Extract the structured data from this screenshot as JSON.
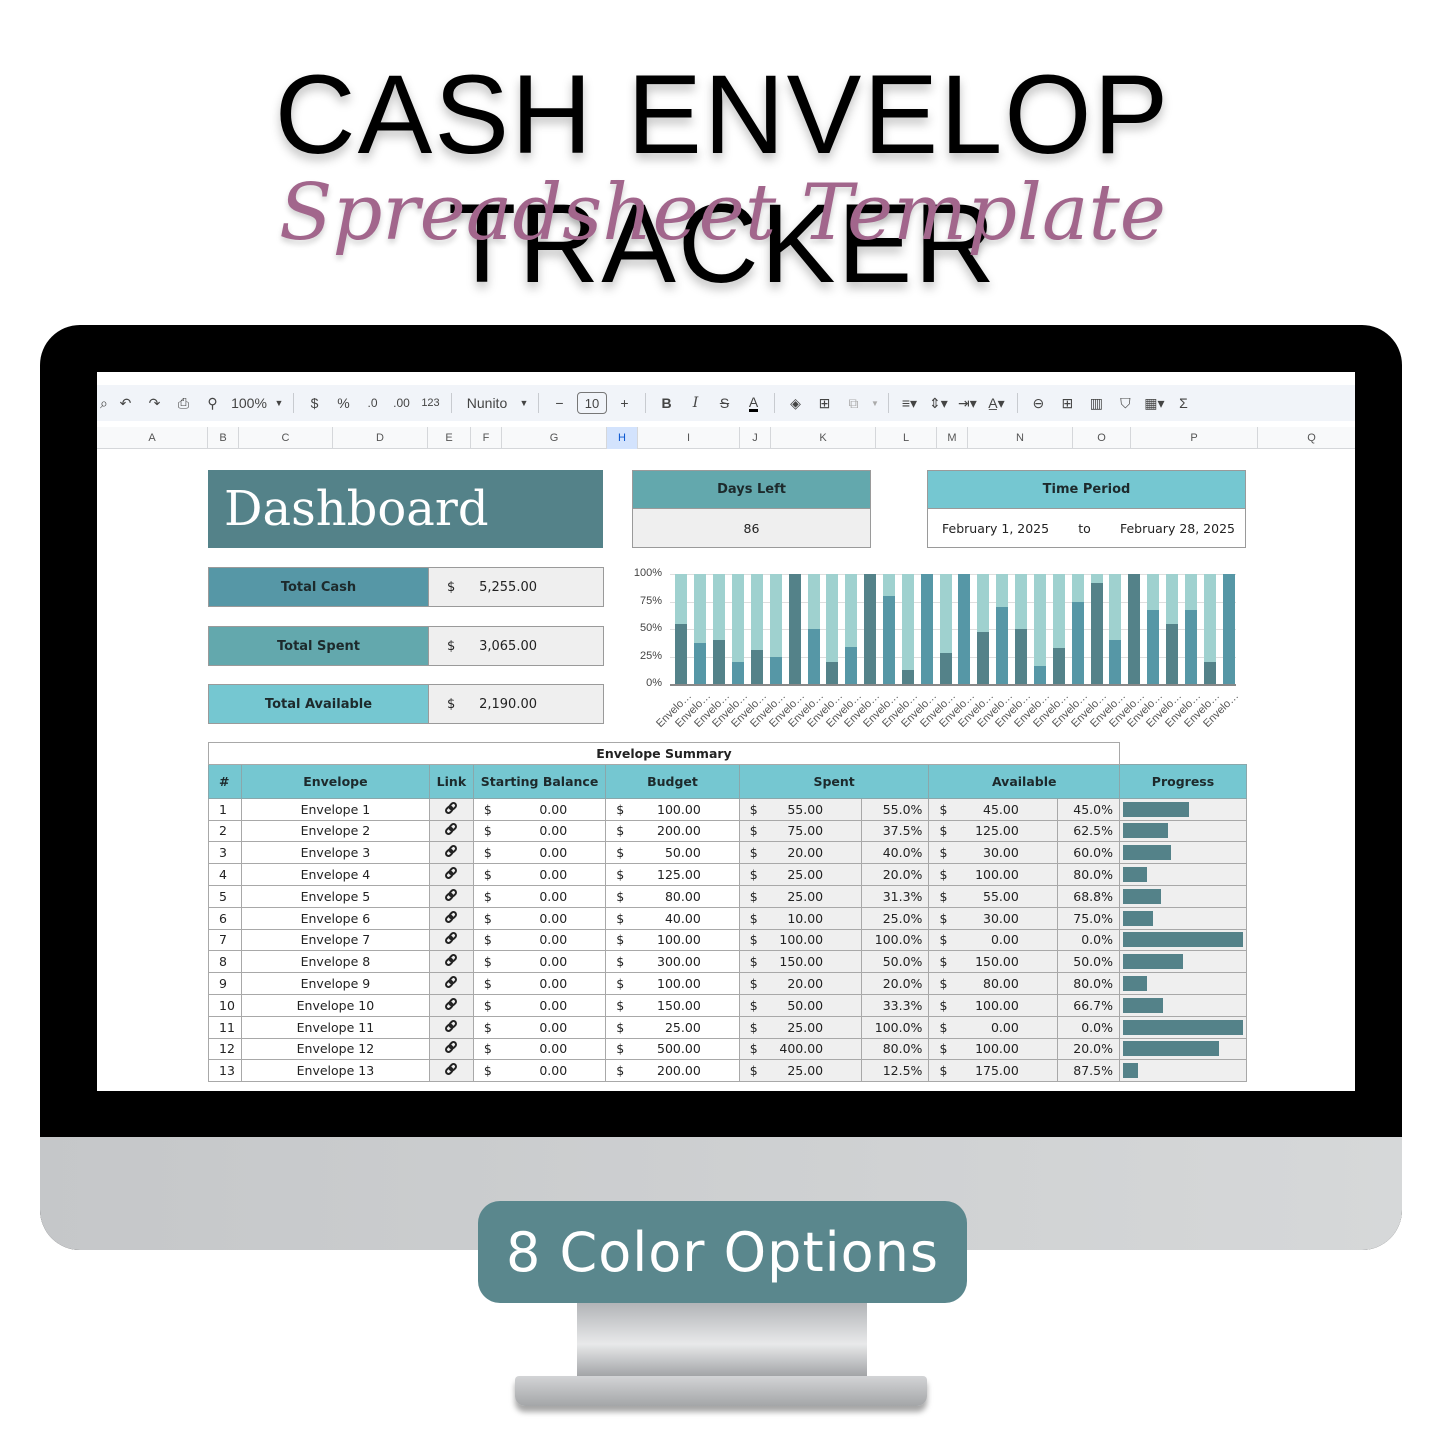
{
  "hero": {
    "title": "CASH ENVELOP TRACKER",
    "subtitle": "Spreadsheet Template",
    "subtitle_color": "#a2668c"
  },
  "badge": {
    "label": "8 Color Options",
    "color": "#5a878d"
  },
  "toolbar": {
    "zoom": "100%",
    "currency": "$",
    "percent": "%",
    "dec_decrease": ".0",
    "dec_increase": ".00",
    "number_format": "123",
    "font": "Nunito",
    "font_size": "10",
    "minus": "−",
    "plus": "+",
    "bold": "B",
    "italic": "I",
    "strike": "S",
    "text_color": "A",
    "sigma": "Σ"
  },
  "columns": [
    "A",
    "B",
    "C",
    "D",
    "E",
    "F",
    "G",
    "H",
    "I",
    "J",
    "K",
    "L",
    "M",
    "N",
    "O",
    "P",
    "Q"
  ],
  "selected_column": "H",
  "dashboard": {
    "title": "Dashboard",
    "kpis": [
      {
        "label": "Total Cash",
        "currency": "$",
        "value": "5,255.00",
        "color": "#5697a6"
      },
      {
        "label": "Total Spent",
        "currency": "$",
        "value": "3,065.00",
        "color": "#63a8ad"
      },
      {
        "label": "Total Available",
        "currency": "$",
        "value": "2,190.00",
        "color": "#75c7d1"
      }
    ],
    "days_left": {
      "label": "Days Left",
      "value": "86"
    },
    "time_period": {
      "label": "Time Period",
      "start": "February 1, 2025",
      "to": "to",
      "end": "February 28, 2025"
    }
  },
  "colors": {
    "dark_teal": "#548289",
    "mid_teal": "#5697a6",
    "light_teal": "#75c7d1",
    "pale_teal": "#9fd1cf"
  },
  "chart_data": {
    "type": "bar",
    "stacked": "percent",
    "title": "",
    "xlabel": "",
    "ylabel": "",
    "ylim": [
      0,
      100
    ],
    "yticks": [
      "0%",
      "25%",
      "50%",
      "75%",
      "100%"
    ],
    "grid": true,
    "legend": "none",
    "categories": [
      "Envelo…",
      "Envelo…",
      "Envelo…",
      "Envelo…",
      "Envelo…",
      "Envelo…",
      "Envelo…",
      "Envelo…",
      "Envelo…",
      "Envelo…",
      "Envelo…",
      "Envelo…",
      "Envelo…",
      "Envelo…",
      "Envelo…",
      "Envelo…",
      "Envelo…",
      "Envelo…",
      "Envelo…",
      "Envelo…",
      "Envelo…",
      "Envelo…",
      "Envelo…",
      "Envelo…",
      "Envelo…",
      "Envelo…",
      "Envelo…",
      "Envelo…",
      "Envelo…",
      "Envelo…"
    ],
    "series": [
      {
        "name": "Spent %",
        "values": [
          55,
          37.5,
          40,
          20,
          31.3,
          25,
          100,
          50,
          20,
          33.3,
          100,
          80,
          12.5,
          100,
          28,
          100,
          47,
          70,
          50,
          16,
          33,
          75,
          92,
          40,
          100,
          67,
          55,
          67,
          20,
          100
        ]
      },
      {
        "name": "Available %",
        "values": [
          45,
          62.5,
          60,
          80,
          68.7,
          75,
          0,
          50,
          80,
          66.7,
          0,
          20,
          87.5,
          0,
          72,
          0,
          53,
          30,
          50,
          84,
          67,
          25,
          8,
          60,
          0,
          33,
          45,
          33,
          80,
          0
        ]
      }
    ]
  },
  "summary": {
    "title": "Envelope Summary",
    "headers": [
      "#",
      "Envelope",
      "Link",
      "Starting Balance",
      "Budget",
      "Spent",
      "Available",
      "Progress"
    ],
    "rows": [
      {
        "n": "1",
        "name": "Envelope 1",
        "start": "0.00",
        "budget": "100.00",
        "spent": "55.00",
        "spent_pct": "55.0%",
        "avail": "45.00",
        "avail_pct": "45.0%",
        "progress": 0.55
      },
      {
        "n": "2",
        "name": "Envelope 2",
        "start": "0.00",
        "budget": "200.00",
        "spent": "75.00",
        "spent_pct": "37.5%",
        "avail": "125.00",
        "avail_pct": "62.5%",
        "progress": 0.375
      },
      {
        "n": "3",
        "name": "Envelope 3",
        "start": "0.00",
        "budget": "50.00",
        "spent": "20.00",
        "spent_pct": "40.0%",
        "avail": "30.00",
        "avail_pct": "60.0%",
        "progress": 0.4
      },
      {
        "n": "4",
        "name": "Envelope 4",
        "start": "0.00",
        "budget": "125.00",
        "spent": "25.00",
        "spent_pct": "20.0%",
        "avail": "100.00",
        "avail_pct": "80.0%",
        "progress": 0.2
      },
      {
        "n": "5",
        "name": "Envelope 5",
        "start": "0.00",
        "budget": "80.00",
        "spent": "25.00",
        "spent_pct": "31.3%",
        "avail": "55.00",
        "avail_pct": "68.8%",
        "progress": 0.313
      },
      {
        "n": "6",
        "name": "Envelope 6",
        "start": "0.00",
        "budget": "40.00",
        "spent": "10.00",
        "spent_pct": "25.0%",
        "avail": "30.00",
        "avail_pct": "75.0%",
        "progress": 0.25
      },
      {
        "n": "7",
        "name": "Envelope 7",
        "start": "0.00",
        "budget": "100.00",
        "spent": "100.00",
        "spent_pct": "100.0%",
        "avail": "0.00",
        "avail_pct": "0.0%",
        "progress": 1.0
      },
      {
        "n": "8",
        "name": "Envelope 8",
        "start": "0.00",
        "budget": "300.00",
        "spent": "150.00",
        "spent_pct": "50.0%",
        "avail": "150.00",
        "avail_pct": "50.0%",
        "progress": 0.5
      },
      {
        "n": "9",
        "name": "Envelope 9",
        "start": "0.00",
        "budget": "100.00",
        "spent": "20.00",
        "spent_pct": "20.0%",
        "avail": "80.00",
        "avail_pct": "80.0%",
        "progress": 0.2
      },
      {
        "n": "10",
        "name": "Envelope 10",
        "start": "0.00",
        "budget": "150.00",
        "spent": "50.00",
        "spent_pct": "33.3%",
        "avail": "100.00",
        "avail_pct": "66.7%",
        "progress": 0.333
      },
      {
        "n": "11",
        "name": "Envelope 11",
        "start": "0.00",
        "budget": "25.00",
        "spent": "25.00",
        "spent_pct": "100.0%",
        "avail": "0.00",
        "avail_pct": "0.0%",
        "progress": 1.0
      },
      {
        "n": "12",
        "name": "Envelope 12",
        "start": "0.00",
        "budget": "500.00",
        "spent": "400.00",
        "spent_pct": "80.0%",
        "avail": "100.00",
        "avail_pct": "20.0%",
        "progress": 0.8
      },
      {
        "n": "13",
        "name": "Envelope 13",
        "start": "0.00",
        "budget": "200.00",
        "spent": "25.00",
        "spent_pct": "12.5%",
        "avail": "175.00",
        "avail_pct": "87.5%",
        "progress": 0.125
      }
    ],
    "currency": "$"
  }
}
